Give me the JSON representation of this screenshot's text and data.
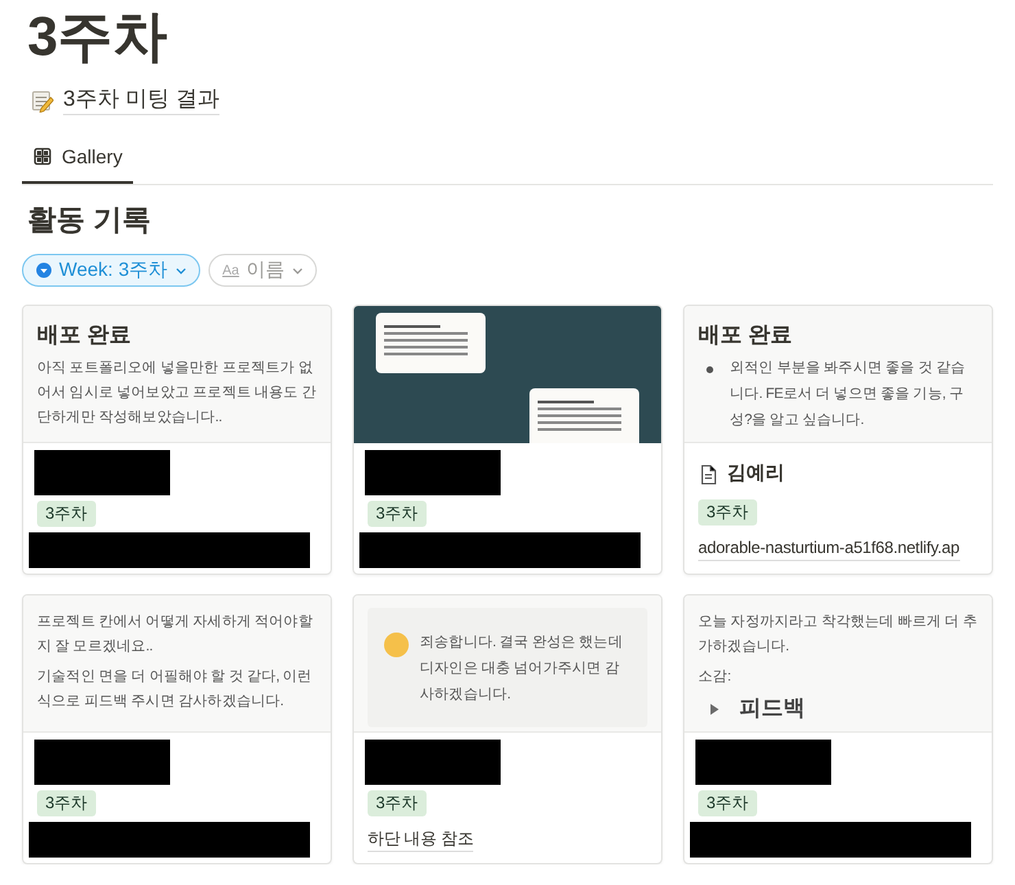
{
  "page": {
    "title": "3주차",
    "linked_page": "3주차 미팅 결과"
  },
  "tabs": [
    {
      "label": "Gallery",
      "selected": true
    }
  ],
  "section_title": "활동 기록",
  "filters": [
    {
      "kind": "property",
      "label": "Week: 3주차",
      "active": true
    },
    {
      "kind": "sort",
      "icon_text": "Aa",
      "label": "이름",
      "active": false
    }
  ],
  "cards": [
    {
      "cover": {
        "kind": "text",
        "blocks": [
          {
            "kind": "heading",
            "text": "배포 완료"
          },
          {
            "kind": "paragraph",
            "text": "아직 포트폴리오에 넣을만한 프로젝트가 없어서 임시로 넣어보았고 프로젝트 내용도 간단하게만 작성해보았습니다.."
          }
        ]
      },
      "name_hidden": true,
      "tag": "3주차",
      "link_hidden": true
    },
    {
      "cover": {
        "kind": "image"
      },
      "name_hidden": true,
      "tag": "3주차",
      "link_hidden": true
    },
    {
      "cover": {
        "kind": "text",
        "blocks": [
          {
            "kind": "heading",
            "text": "배포 완료"
          },
          {
            "kind": "bullet",
            "text": "외적인 부분을 봐주시면 좋을 것 같습니다. FE로서 더 넣으면 좋을 기능, 구성?을 알고 싶습니다."
          }
        ]
      },
      "name_hidden": false,
      "name": "김예리",
      "tag": "3주차",
      "link_hidden": false,
      "link": "adorable-nasturtium-a51f68.netlify.ap"
    },
    {
      "cover": {
        "kind": "text",
        "blocks": [
          {
            "kind": "paragraph",
            "text": "프로젝트 칸에서 어떻게 자세하게 적어야할지 잘 모르겠네요.."
          },
          {
            "kind": "paragraph",
            "text": "기술적인 면을 더 어필해야 할 것 같다, 이런 식으로 피드백 주시면 감사하겠습니다."
          }
        ]
      },
      "name_hidden": true,
      "tag": "3주차",
      "link_hidden": true
    },
    {
      "cover": {
        "kind": "text",
        "blocks": [
          {
            "kind": "callout",
            "text": "죄송합니다. 결국 완성은 했는데 디자인은 대충 넘어가주시면 감사하겠습니다."
          }
        ]
      },
      "name_hidden": true,
      "tag": "3주차",
      "link_hidden": false,
      "link": "하단 내용 참조"
    },
    {
      "cover": {
        "kind": "text",
        "blocks": [
          {
            "kind": "paragraph",
            "text": "오늘 자정까지라고 착각했는데 빠르게 더 추가하겠습니다."
          },
          {
            "kind": "paragraph",
            "text": "소감:"
          },
          {
            "kind": "toggle",
            "text": "피드백"
          }
        ]
      },
      "name_hidden": true,
      "tag": "3주차",
      "link_hidden": true
    }
  ]
}
